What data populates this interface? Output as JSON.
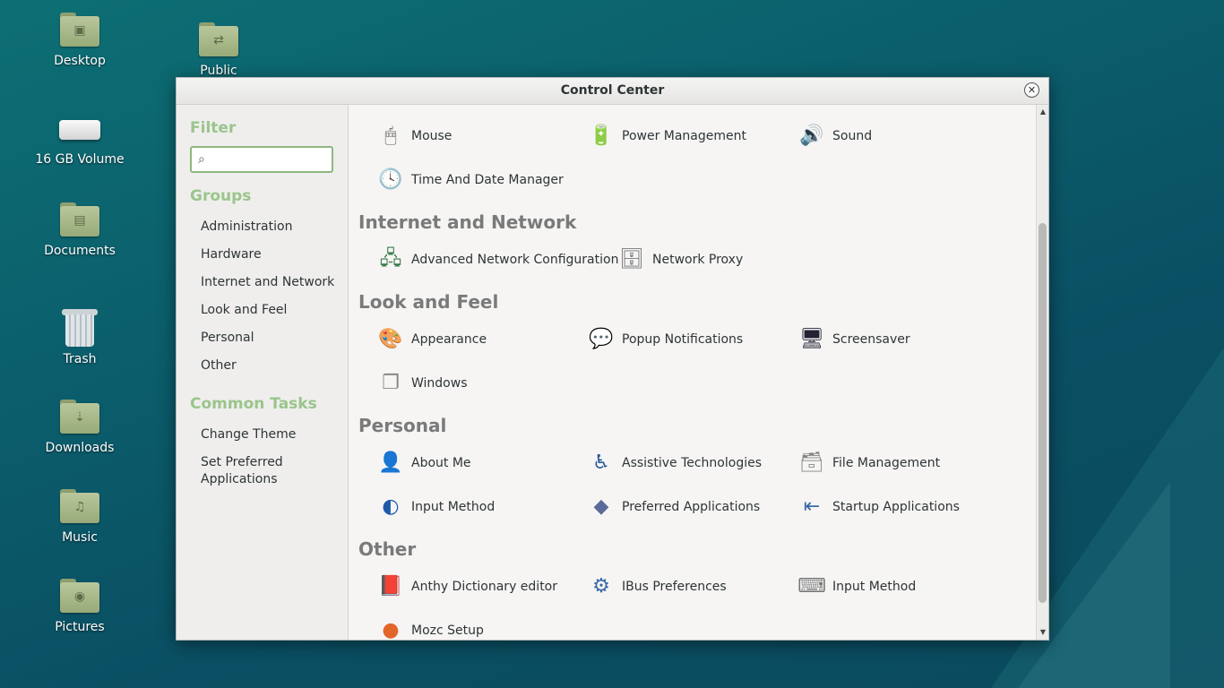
{
  "desktop": {
    "icons": [
      {
        "label": "Desktop",
        "glyph": "▣"
      },
      {
        "label": "Public",
        "glyph": "⇄"
      },
      {
        "label": "16 GB Volume"
      },
      {
        "label": "Documents",
        "glyph": "▤"
      },
      {
        "label": "Trash"
      },
      {
        "label": "Downloads",
        "glyph": "⇣"
      },
      {
        "label": "Music",
        "glyph": "♫"
      },
      {
        "label": "Pictures",
        "glyph": "◉"
      }
    ]
  },
  "window": {
    "title": "Control Center",
    "close_glyph": "✕"
  },
  "sidebar": {
    "filter_heading": "Filter",
    "search_placeholder": "",
    "search_value": "",
    "groups_heading": "Groups",
    "groups": [
      "Administration",
      "Hardware",
      "Internet and Network",
      "Look and Feel",
      "Personal",
      "Other"
    ],
    "tasks_heading": "Common Tasks",
    "tasks": [
      "Change Theme",
      "Set Preferred Applications"
    ]
  },
  "content": {
    "hardware_row1": [
      "Mouse",
      "Power Management",
      "Sound"
    ],
    "hardware_row2": [
      "Time And Date Manager"
    ],
    "internet": {
      "title": "Internet and Network",
      "items": [
        "Advanced Network Configuration",
        "Network Proxy"
      ]
    },
    "look": {
      "title": "Look and Feel",
      "row1": [
        "Appearance",
        "Popup Notifications",
        "Screensaver"
      ],
      "row2": [
        "Windows"
      ]
    },
    "personal": {
      "title": "Personal",
      "row1": [
        "About Me",
        "Assistive Technologies",
        "File Management"
      ],
      "row2": [
        "Input Method",
        "Preferred Applications",
        "Startup Applications"
      ]
    },
    "other": {
      "title": "Other",
      "row1": [
        "Anthy Dictionary editor",
        "IBus Preferences",
        "Input Method"
      ],
      "row2": [
        "Mozc Setup"
      ]
    }
  },
  "colors": {
    "accent_green": "#9ac58b",
    "section_gray": "#7a7a7a",
    "desktop_teal": "#0b5e6c"
  }
}
